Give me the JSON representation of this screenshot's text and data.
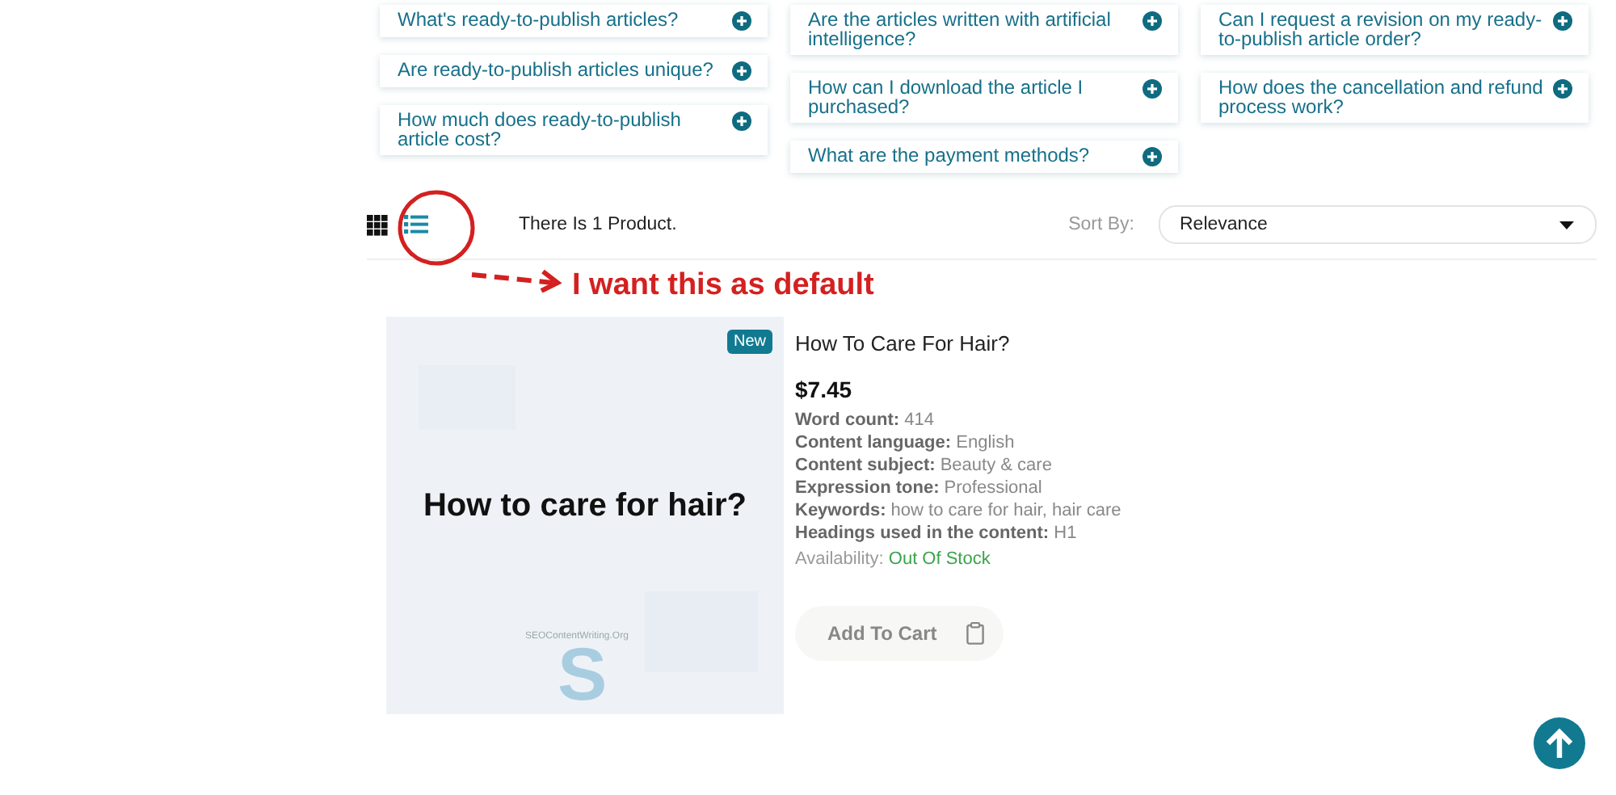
{
  "faq_columns": [
    {
      "items": [
        {
          "question": "What's ready-to-publish articles?",
          "expanded": false
        },
        {
          "question": "Are ready-to-publish articles unique?",
          "expanded": false
        },
        {
          "question": "How much does ready-to-publish article cost?",
          "expanded": false
        }
      ]
    },
    {
      "items": [
        {
          "question": "Are the articles written with artificial intelligence?",
          "expanded": false
        },
        {
          "question": "How can I download the article I purchased?",
          "expanded": false
        },
        {
          "question": "What are the payment methods?",
          "expanded": false
        }
      ]
    },
    {
      "items": [
        {
          "question": "Can I request a revision on my ready-to-publish article order?",
          "expanded": false
        },
        {
          "question": "How does the cancellation and refund process work?",
          "expanded": false
        }
      ]
    }
  ],
  "view_toggle": [
    {
      "kind": "grid",
      "selected": false
    },
    {
      "kind": "list",
      "selected": true
    }
  ],
  "product_count": "There Is 1 Product.",
  "sort": {
    "label": "Sort By:",
    "value": "Relevance"
  },
  "annotation": {
    "text": "I want this as default"
  },
  "product": {
    "badge": "New",
    "image": {
      "caption": "How to care for hair?",
      "logo_letter": "S",
      "logo_text": "SEOContentWriting.Org"
    },
    "title": "How To Care For Hair?",
    "price": "$7.45",
    "details": [
      {
        "label": "Word count:",
        "value": "414"
      },
      {
        "label": "Content language:",
        "value": "English"
      },
      {
        "label": "Content subject:",
        "value": "Beauty & care"
      },
      {
        "label": "Expression tone:",
        "value": "Professional"
      },
      {
        "label": "Keywords:",
        "value": "how to care for hair, hair care"
      },
      {
        "label": "Headings used in the content:",
        "value": "H1"
      }
    ],
    "availability": {
      "label": "Availability:",
      "value": "Out Of Stock",
      "in_stock": false
    },
    "add_to_cart": {
      "label": "Add To Cart",
      "disabled": true
    }
  }
}
